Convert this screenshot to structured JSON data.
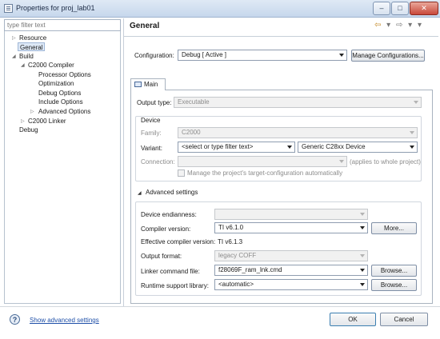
{
  "window": {
    "title": "Properties for proj_lab01",
    "controls": {
      "minimize": "–",
      "maximize": "□",
      "close": "✕"
    }
  },
  "sidebar": {
    "filter_placeholder": "type filter text",
    "items": [
      {
        "label": "Resource",
        "expander": "▷"
      },
      {
        "label": "General",
        "selected": true
      },
      {
        "label": "Build",
        "expander": "◢"
      },
      {
        "label": "C2000 Compiler",
        "expander": "◢"
      },
      {
        "label": "Processor Options"
      },
      {
        "label": "Optimization"
      },
      {
        "label": "Debug Options"
      },
      {
        "label": "Include Options"
      },
      {
        "label": "Advanced Options",
        "expander": "▷"
      },
      {
        "label": "C2000 Linker",
        "expander": "▷"
      },
      {
        "label": "Debug"
      }
    ]
  },
  "header": {
    "title": "General",
    "nav_back": "⇦",
    "nav_forward": "⇨",
    "nav_menu": "▾"
  },
  "configuration": {
    "label": "Configuration:",
    "value": "Debug  [ Active ]",
    "manage_label": "Manage Configurations..."
  },
  "tabs": {
    "main": "Main"
  },
  "main": {
    "output_type_label": "Output type:",
    "output_type_value": "Executable",
    "device": {
      "title": "Device",
      "family_label": "Family:",
      "family_value": "C2000",
      "variant_label": "Variant:",
      "variant_filter_value": "<select or type filter text>",
      "variant_value": "Generic C28xx Device",
      "connection_label": "Connection:",
      "connection_value": "",
      "connection_note": "(applies to whole project)",
      "manage_target_label": "Manage the project's target-configuration automatically"
    },
    "advanced": {
      "title": "Advanced settings",
      "expander": "◢",
      "endianness_label": "Device endianness:",
      "endianness_value": "",
      "compiler_version_label": "Compiler version:",
      "compiler_version_value": "TI v6.1.0",
      "more_label": "More...",
      "effective_label": "Effective compiler version:",
      "effective_value": "TI v6.1.3",
      "output_format_label": "Output format:",
      "output_format_value": "legacy COFF",
      "linker_cmd_label": "Linker command file:",
      "linker_cmd_value": "f28069F_ram_lnk.cmd",
      "browse_label": "Browse...",
      "runtime_label": "Runtime support library:",
      "runtime_value": "<automatic>"
    }
  },
  "footer": {
    "help_icon": "?",
    "show_advanced": "Show advanced settings",
    "ok": "OK",
    "cancel": "Cancel"
  },
  "colors": {
    "accent": "#1e4fa8",
    "selection": "#dde8f6",
    "close": "#c8483a"
  }
}
